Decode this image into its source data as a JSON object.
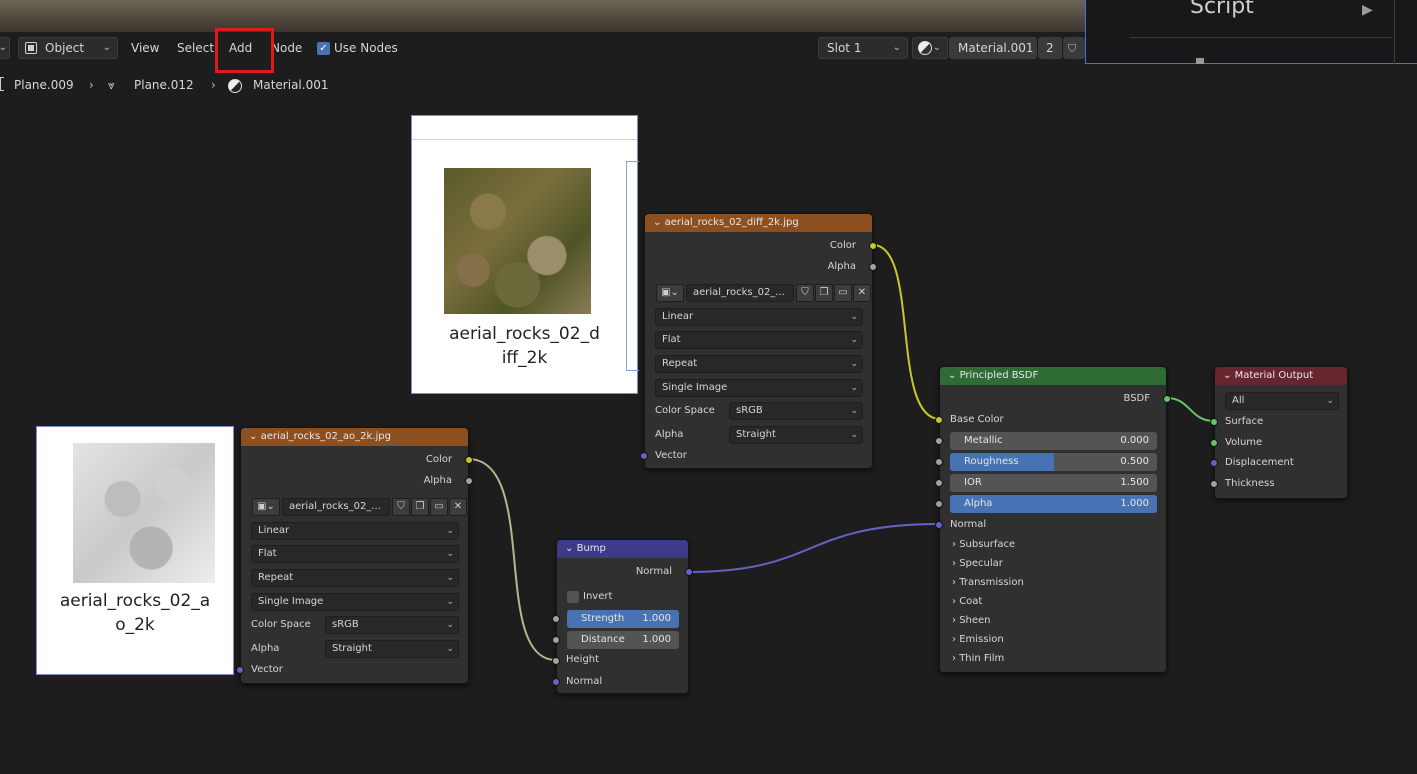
{
  "header": {
    "editor_type": "",
    "mode": "Object",
    "menu": {
      "view": "View",
      "select": "Select",
      "add": "Add",
      "node": "Node"
    },
    "use_nodes_label": "Use Nodes",
    "slot": "Slot 1",
    "material_name": "Material.001",
    "user_count": "2"
  },
  "script_panel": {
    "label": "Script"
  },
  "breadcrumb": {
    "object": "Plane.009",
    "mesh": "Plane.012",
    "material": "Material.001"
  },
  "previews": {
    "diff": {
      "caption_line1": "aerial_rocks_02_d",
      "caption_line2": "iff_2k"
    },
    "ao": {
      "caption_line1": "aerial_rocks_02_a",
      "caption_line2": "o_2k"
    }
  },
  "diff_node": {
    "title": "aerial_rocks_02_diff_2k.jpg",
    "out_color": "Color",
    "out_alpha": "Alpha",
    "image_name": "aerial_rocks_02_...",
    "interpolation": "Linear",
    "projection": "Flat",
    "extension": "Repeat",
    "source": "Single Image",
    "color_space_label": "Color Space",
    "color_space": "sRGB",
    "alpha_label": "Alpha",
    "alpha_mode": "Straight",
    "in_vector": "Vector"
  },
  "ao_node": {
    "title": "aerial_rocks_02_ao_2k.jpg",
    "out_color": "Color",
    "out_alpha": "Alpha",
    "image_name": "aerial_rocks_02_...",
    "interpolation": "Linear",
    "projection": "Flat",
    "extension": "Repeat",
    "source": "Single Image",
    "color_space_label": "Color Space",
    "color_space": "sRGB",
    "alpha_label": "Alpha",
    "alpha_mode": "Straight",
    "in_vector": "Vector"
  },
  "bump_node": {
    "title": "Bump",
    "out_normal": "Normal",
    "invert": "Invert",
    "strength_label": "Strength",
    "strength": "1.000",
    "distance_label": "Distance",
    "distance": "1.000",
    "in_height": "Height",
    "in_normal": "Normal"
  },
  "bsdf_node": {
    "title": "Principled BSDF",
    "out_bsdf": "BSDF",
    "base_color": "Base Color",
    "metallic_label": "Metallic",
    "metallic": "0.000",
    "metallic_fill": 0.0,
    "roughness_label": "Roughness",
    "roughness": "0.500",
    "roughness_fill": 0.5,
    "ior_label": "IOR",
    "ior": "1.500",
    "ior_fill": 0.0,
    "alpha_label": "Alpha",
    "alpha": "1.000",
    "alpha_fill": 1.0,
    "normal": "Normal",
    "panels": [
      "Subsurface",
      "Specular",
      "Transmission",
      "Coat",
      "Sheen",
      "Emission",
      "Thin Film"
    ]
  },
  "output_node": {
    "title": "Material Output",
    "target": "All",
    "surface": "Surface",
    "volume": "Volume",
    "displacement": "Displacement",
    "thickness": "Thickness"
  },
  "colors": {
    "image_header": "#8c4f20",
    "vector_header": "#3b3b8a",
    "shader_header": "#2f6b35",
    "output_header": "#66252f",
    "socket_color": "#c7c729",
    "socket_float": "#a1a1a1",
    "socket_vector": "#6363c7",
    "socket_shader": "#63c763",
    "highlight": "#e01a1a",
    "selection_blue": "#4772b3"
  }
}
